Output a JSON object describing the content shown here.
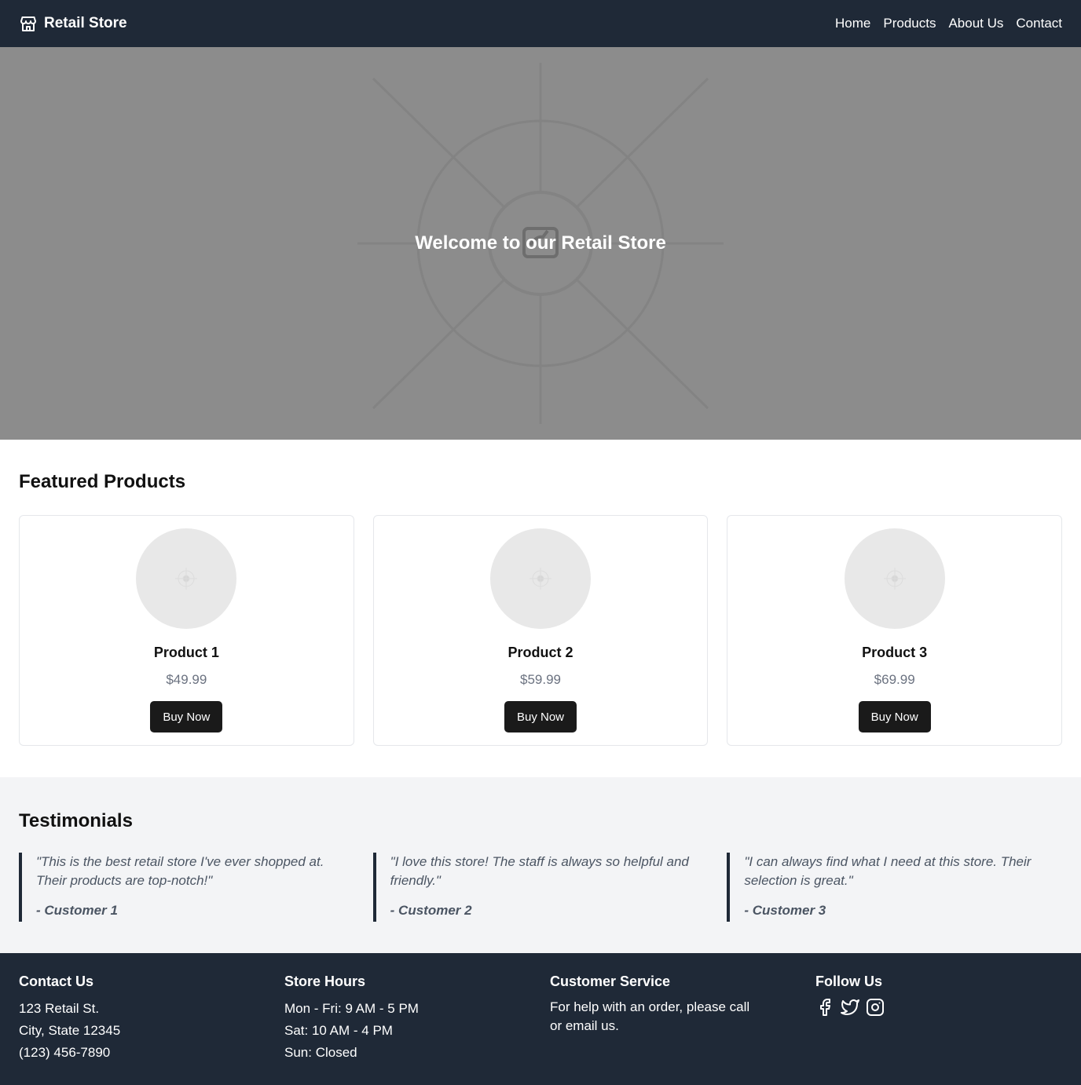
{
  "header": {
    "brand": "Retail Store",
    "brand_icon": "store-icon",
    "nav": [
      "Home",
      "Products",
      "About Us",
      "Contact"
    ]
  },
  "hero": {
    "title": "Welcome to our Retail Store",
    "background_color": "#8c8c8c"
  },
  "featured": {
    "title": "Featured Products",
    "products": [
      {
        "name": "Product 1",
        "price": "$49.99",
        "button": "Buy Now"
      },
      {
        "name": "Product 2",
        "price": "$59.99",
        "button": "Buy Now"
      },
      {
        "name": "Product 3",
        "price": "$69.99",
        "button": "Buy Now"
      }
    ]
  },
  "testimonials": {
    "title": "Testimonials",
    "items": [
      {
        "text": "\"This is the best retail store I've ever shopped at. Their products are top-notch!\"",
        "author": "- Customer 1"
      },
      {
        "text": "\"I love this store! The staff is always so helpful and friendly.\"",
        "author": "- Customer 2"
      },
      {
        "text": "\"I can always find what I need at this store. Their selection is great.\"",
        "author": "- Customer 3"
      }
    ]
  },
  "footer": {
    "contact": {
      "title": "Contact Us",
      "lines": [
        "123 Retail St.",
        "City, State 12345",
        "(123) 456-7890"
      ]
    },
    "hours": {
      "title": "Store Hours",
      "lines": [
        "Mon - Fri: 9 AM - 5 PM",
        "Sat: 10 AM - 4 PM",
        "Sun: Closed"
      ]
    },
    "service": {
      "title": "Customer Service",
      "text": "For help with an order, please call or email us."
    },
    "follow": {
      "title": "Follow Us",
      "icons": [
        "facebook-icon",
        "twitter-icon",
        "instagram-icon"
      ]
    }
  },
  "colors": {
    "header_bg": "#1f2937",
    "accent_dark": "#1a1a1a",
    "muted_text": "#6b7280",
    "testimonial_bg": "#f3f4f6"
  }
}
